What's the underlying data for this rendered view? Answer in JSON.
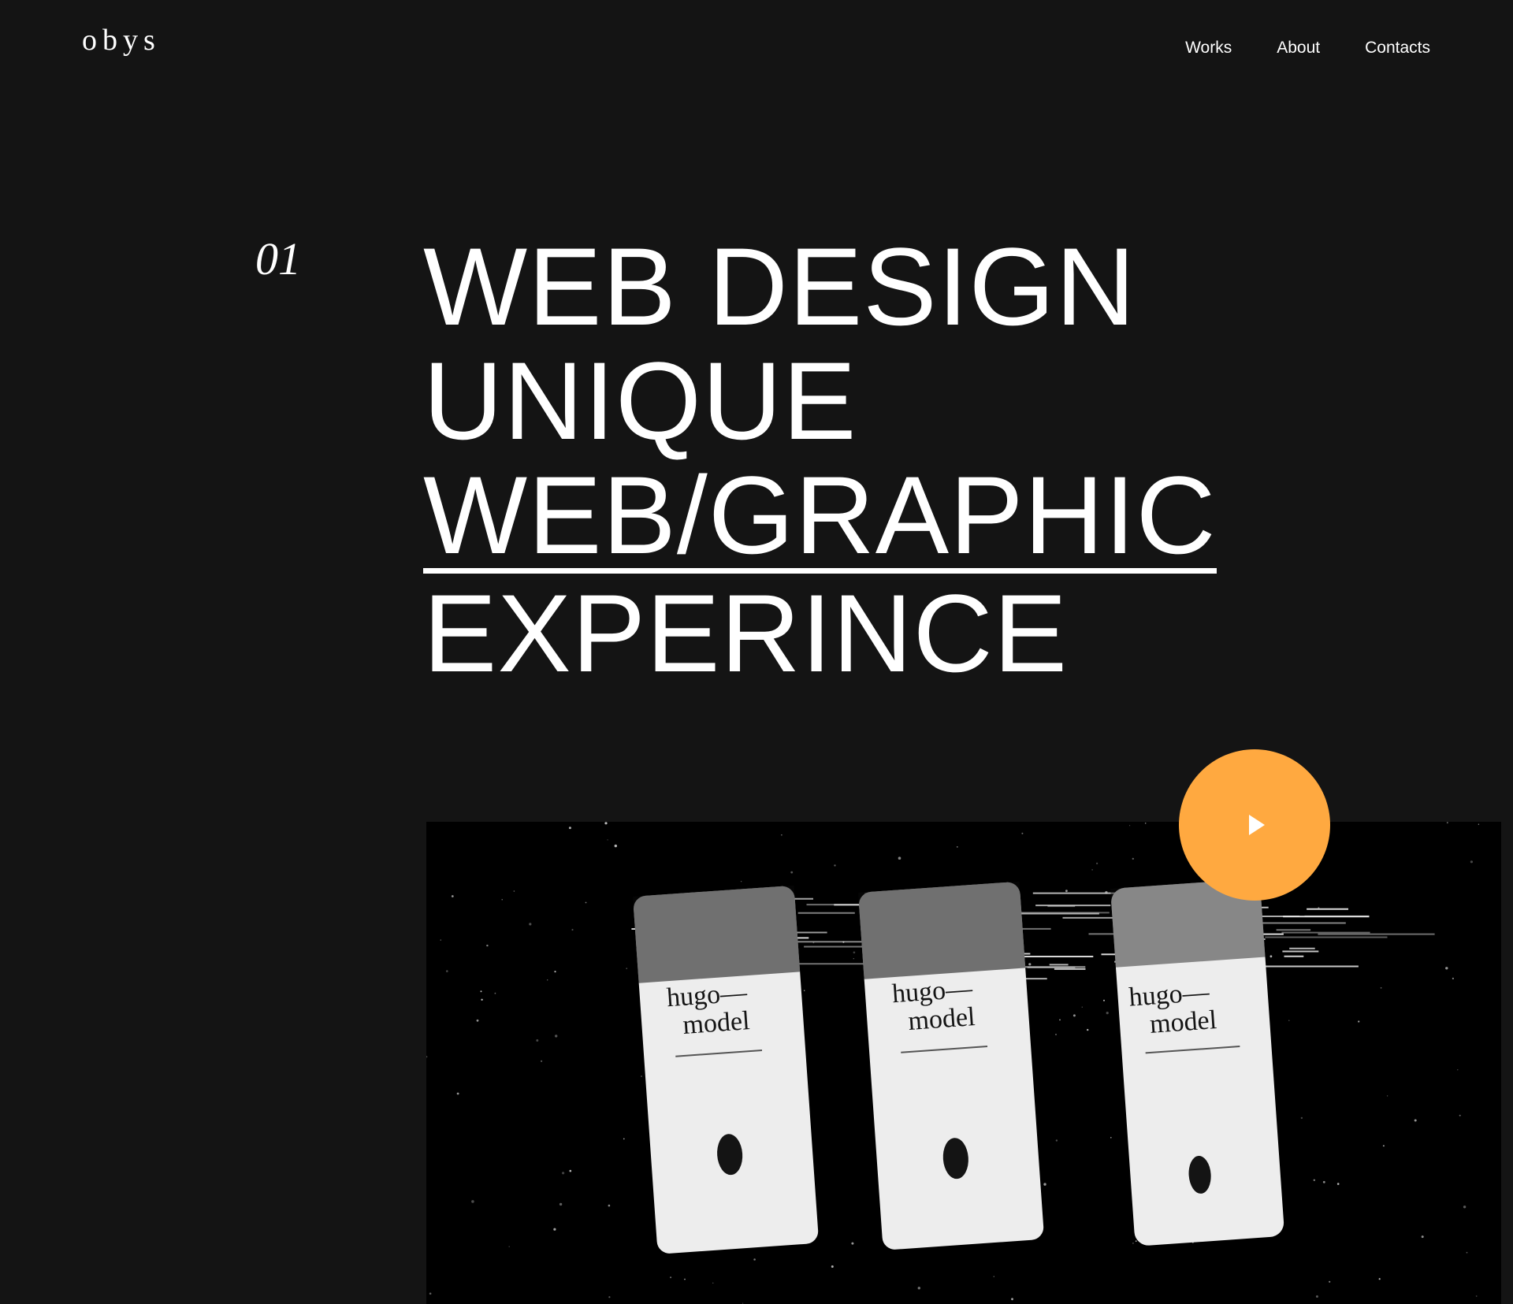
{
  "header": {
    "logo": "obys",
    "nav": [
      {
        "label": "Works"
      },
      {
        "label": "About"
      },
      {
        "label": "Contacts"
      }
    ]
  },
  "hero": {
    "index": "01",
    "lines": [
      "WEB DESIGN",
      "UNIQUE",
      "WEB/GRAPHIC",
      "EXPERINCE"
    ]
  },
  "media": {
    "cards": [
      {
        "line1": "hugo—",
        "line2": "model"
      },
      {
        "line1": "hugo—",
        "line2": "model"
      },
      {
        "line1": "hugo—",
        "line2": "model"
      }
    ],
    "play_icon": "play-icon"
  },
  "colors": {
    "background": "#141414",
    "text": "#ffffff",
    "accent": "#ffa940"
  }
}
